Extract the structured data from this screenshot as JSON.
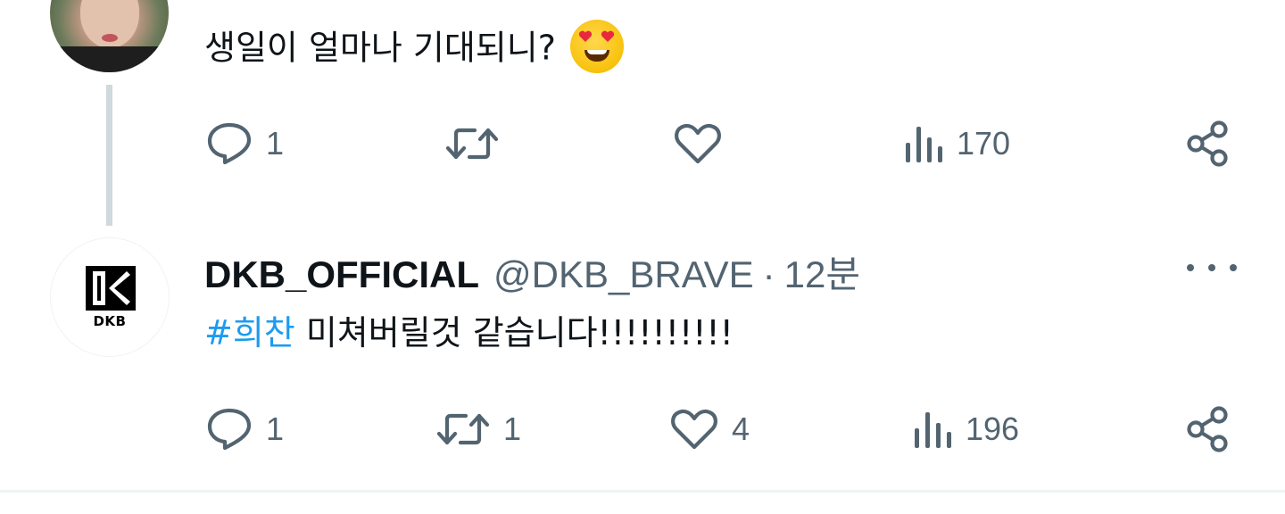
{
  "colors": {
    "text": "#0f1419",
    "secondary": "#536471",
    "link": "#1d9bf0",
    "thread_line": "#cfd9de",
    "border": "#eff3f4"
  },
  "tweets": [
    {
      "text": "생일이 얼마나 기대되니?",
      "emoji": "smiling-face-with-heart-eyes",
      "actions": {
        "reply_count": "1",
        "retweet_count": "",
        "like_count": "",
        "view_count": "170"
      }
    },
    {
      "author": {
        "display_name": "DKB_OFFICIAL",
        "handle": "@DKB_BRAVE",
        "separator": "·",
        "time": "12분",
        "avatar_text": "DKB"
      },
      "hashtag": "#희찬",
      "text": " 미쳐버릴것 같습니다!!!!!!!!!!",
      "actions": {
        "reply_count": "1",
        "retweet_count": "1",
        "like_count": "4",
        "view_count": "196"
      }
    }
  ]
}
